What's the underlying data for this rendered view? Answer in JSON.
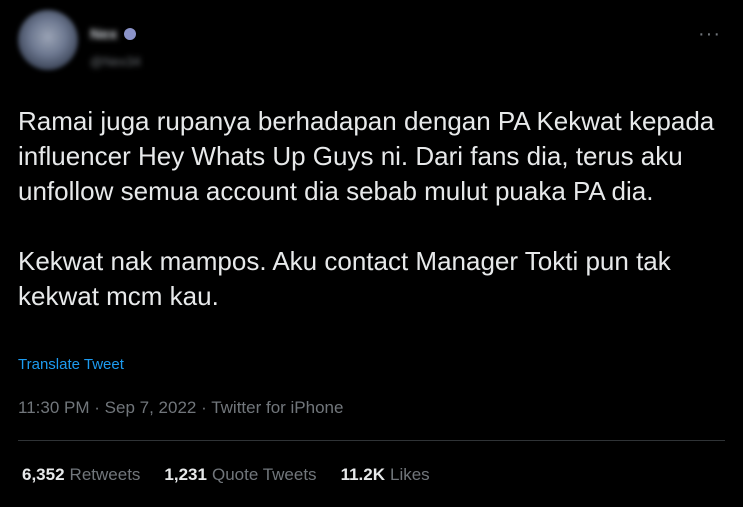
{
  "author": {
    "name": "Nex",
    "handle": "@Nex34"
  },
  "menu_icon": "more-horizontal-icon",
  "tweet": {
    "paragraphs": [
      "Ramai juga rupanya berhadapan dengan PA Kekwat kepada influencer Hey Whats Up Guys ni. Dari fans dia, terus aku unfollow semua account dia sebab mulut puaka PA dia.",
      "Kekwat nak mampos. Aku contact Manager Tokti pun tak kekwat mcm kau."
    ],
    "translate_label": "Translate Tweet",
    "time": "11:30 PM",
    "separator": "·",
    "date": "Sep 7, 2022",
    "source": "Twitter for iPhone"
  },
  "stats": {
    "retweets_count": "6,352",
    "retweets_label": "Retweets",
    "quotes_count": "1,231",
    "quotes_label": "Quote Tweets",
    "likes_count": "11.2K",
    "likes_label": "Likes"
  },
  "colors": {
    "background": "#000000",
    "text": "#e7e9ea",
    "secondary": "#71767b",
    "link": "#1d9bf0",
    "divider": "#2f3336"
  }
}
